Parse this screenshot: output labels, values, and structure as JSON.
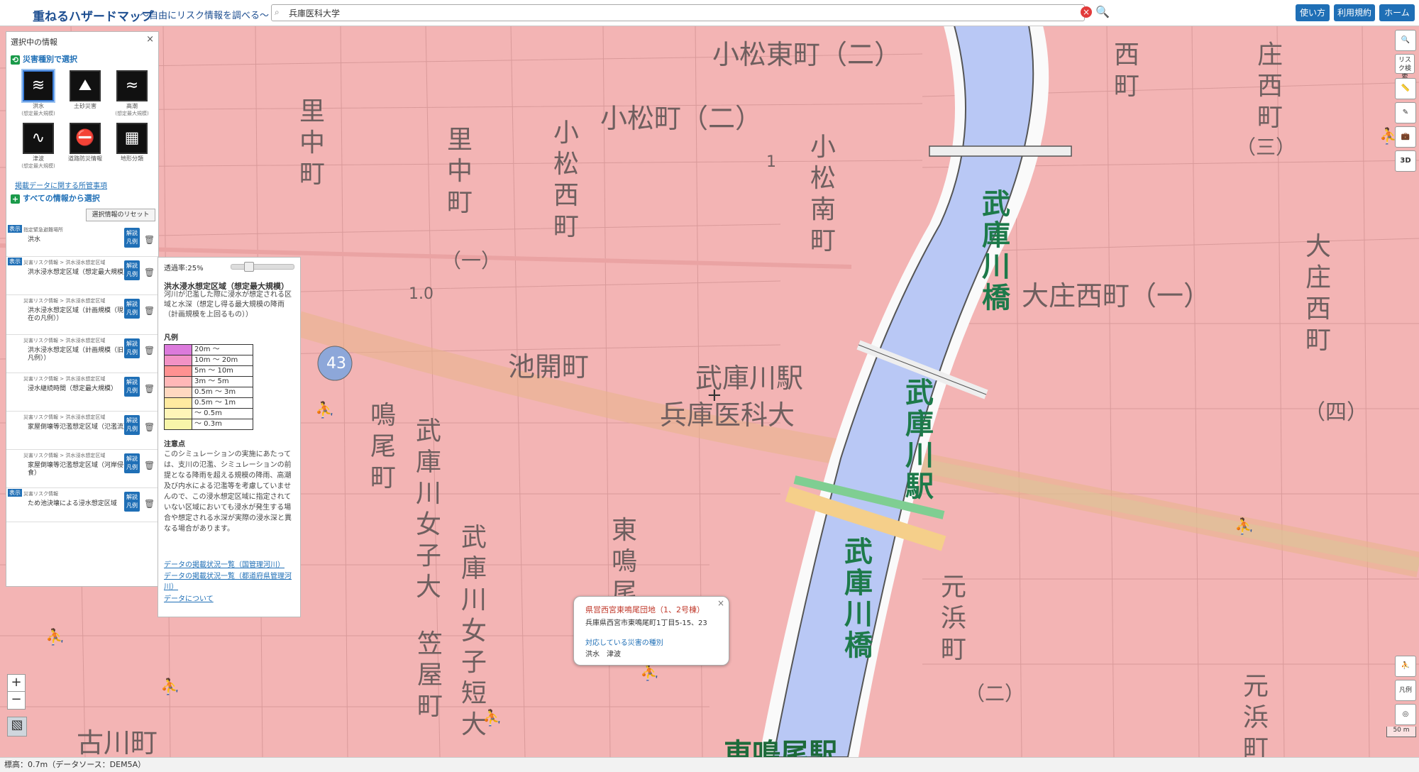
{
  "header": {
    "app_title": "重ねるハザードマップ",
    "app_subtitle": "〜自由にリスク情報を調べる〜",
    "search_value": "兵庫医科大学",
    "buttons": [
      "使い方",
      "利用規約",
      "ホーム"
    ]
  },
  "panel": {
    "title": "選択中の情報",
    "close": "×",
    "hazard_section": "災害種別で選択",
    "hazards": [
      {
        "label": "洪水",
        "note": "(想定最大規模)",
        "icon": "flood-icon"
      },
      {
        "label": "土砂災害",
        "note": "",
        "icon": "landslide-icon"
      },
      {
        "label": "高潮",
        "note": "(想定最大規模)",
        "icon": "storm-surge-icon"
      },
      {
        "label": "津波",
        "note": "(想定最大規模)",
        "icon": "tsunami-icon"
      },
      {
        "label": "道路防災情報",
        "note": "",
        "icon": "road-icon"
      },
      {
        "label": "地形分類",
        "note": "",
        "icon": "terrain-icon"
      }
    ],
    "data_link": "掲載データに関する所管事項",
    "all_section": "すべての情報から選択",
    "reset_button": "選択情報のリセット",
    "layers": [
      {
        "badge": "表示",
        "category": "指定緊急避難場所",
        "name": "洪水"
      },
      {
        "badge": "表示",
        "category": "災害リスク情報 > 洪水浸水想定区域",
        "name": "洪水浸水想定区域（想定最大規模）"
      },
      {
        "badge": "",
        "category": "災害リスク情報 > 洪水浸水想定区域",
        "name": "洪水浸水想定区域（計画規模（現在の凡例））"
      },
      {
        "badge": "",
        "category": "災害リスク情報 > 洪水浸水想定区域",
        "name": "洪水浸水想定区域（計画規模（旧凡例））"
      },
      {
        "badge": "",
        "category": "災害リスク情報 > 洪水浸水想定区域",
        "name": "浸水継続時間（想定最大規模）"
      },
      {
        "badge": "",
        "category": "災害リスク情報 > 洪水浸水想定区域",
        "name": "家屋倒壊等氾濫想定区域（氾濫流）"
      },
      {
        "badge": "",
        "category": "災害リスク情報 > 洪水浸水想定区域",
        "name": "家屋倒壊等氾濫想定区域（河岸侵食）"
      },
      {
        "badge": "表示",
        "category": "災害リスク情報",
        "name": "ため池決壊による浸水想定区域"
      }
    ],
    "layer_button": "解説 凡例"
  },
  "legend": {
    "opacity": "透過率:25%",
    "opacity_value": 0.25,
    "title": "洪水浸水想定区域（想定最大規模）",
    "description": "河川が氾濫した際に浸水が想定される区域と水深（想定し得る最大規模の降雨（計画規模を上回るもの））",
    "legend_header": "凡例",
    "swatches": [
      {
        "label": "20m 〜",
        "color": "#dc7adc"
      },
      {
        "label": "10m 〜 20m",
        "color": "#f292c6"
      },
      {
        "label": "5m 〜 10m",
        "color": "#ff9191"
      },
      {
        "label": "3m 〜 5m",
        "color": "#ffb7b7"
      },
      {
        "label": "0.5m 〜 3m",
        "color": "#ffd8c0"
      },
      {
        "label": "0.5m 〜 1m",
        "color": "#ffeaa0"
      },
      {
        "label": "〜 0.5m",
        "color": "#fff5b8"
      },
      {
        "label": "〜 0.3m",
        "color": "#f7f5a9"
      }
    ],
    "note_header": "注意点",
    "note": "このシミュレーションの実施にあたっては、支川の氾濫、シミュレーションの前提となる降雨を超える規模の降雨、高潮及び内水による氾濫等を考慮していませんので、この浸水想定区域に指定されていない区域においても浸水が発生する場合や想定される水深が実際の浸水深と異なる場合があります。",
    "links": [
      "データの掲載状況一覧（国管理河川）",
      "データの掲載状況一覧（都道府県管理河川）",
      "データについて"
    ]
  },
  "popup": {
    "name": "県営西宮東鳴尾団地（1、2号棟）",
    "address": "兵庫県西宮市東鳴尾町1丁目5-15、23",
    "hazard_header": "対応している災害の種別",
    "hazard_values": "洪水　津波"
  },
  "map_labels": {
    "komatsu_higashi": "小松東町（二）",
    "komatsu": "小松町（二）",
    "satonaka": "里中町",
    "satonaka2": "里中町",
    "komatsu_nishi": "小松西町",
    "komatsu_minami": "小松南町",
    "ikebiraki": "池開町",
    "mukogawa_sta": "武庫川駅",
    "hyogo_ika": "兵庫医科大",
    "naruo": "鳴尾町",
    "mukogawa_joshi": "武庫川女子大",
    "higashi_naruo": "東鳴尾",
    "kasaya": "笠屋町",
    "mukogawa_joshi_tan": "武庫川女子短大",
    "furukawa": "古川町",
    "higashi_naruo_sta": "東鳴尾駅",
    "osho_nishi": "大庄西町（一）",
    "osho_nishi2": "大庄西町",
    "nishi": "西町",
    "shosaimachi": "庄西町",
    "motohama": "元浜町",
    "motohama2": "元浜町",
    "river_bridge1": "武庫川橋",
    "river_station": "武庫川駅",
    "river_bridge2": "武庫川橋",
    "route": "43",
    "num_yon": "（四）",
    "num_ichi": "（一）",
    "num_san": "（三）",
    "num_ni": "（二）",
    "num_10": "1.0",
    "num_1": "1"
  },
  "right_tools": [
    "リスク検索",
    "3D",
    "凡例"
  ],
  "scale": "50 m",
  "status": "標高：0.7m（データソース：DEM5A）",
  "colors": {
    "inundation": "#f3b4b4",
    "river": "#b9c8f5",
    "brand": "#1e4f91",
    "button": "#1f6fb6",
    "shelter": "#1a9a4a",
    "river_label": "#1d7a4a"
  }
}
